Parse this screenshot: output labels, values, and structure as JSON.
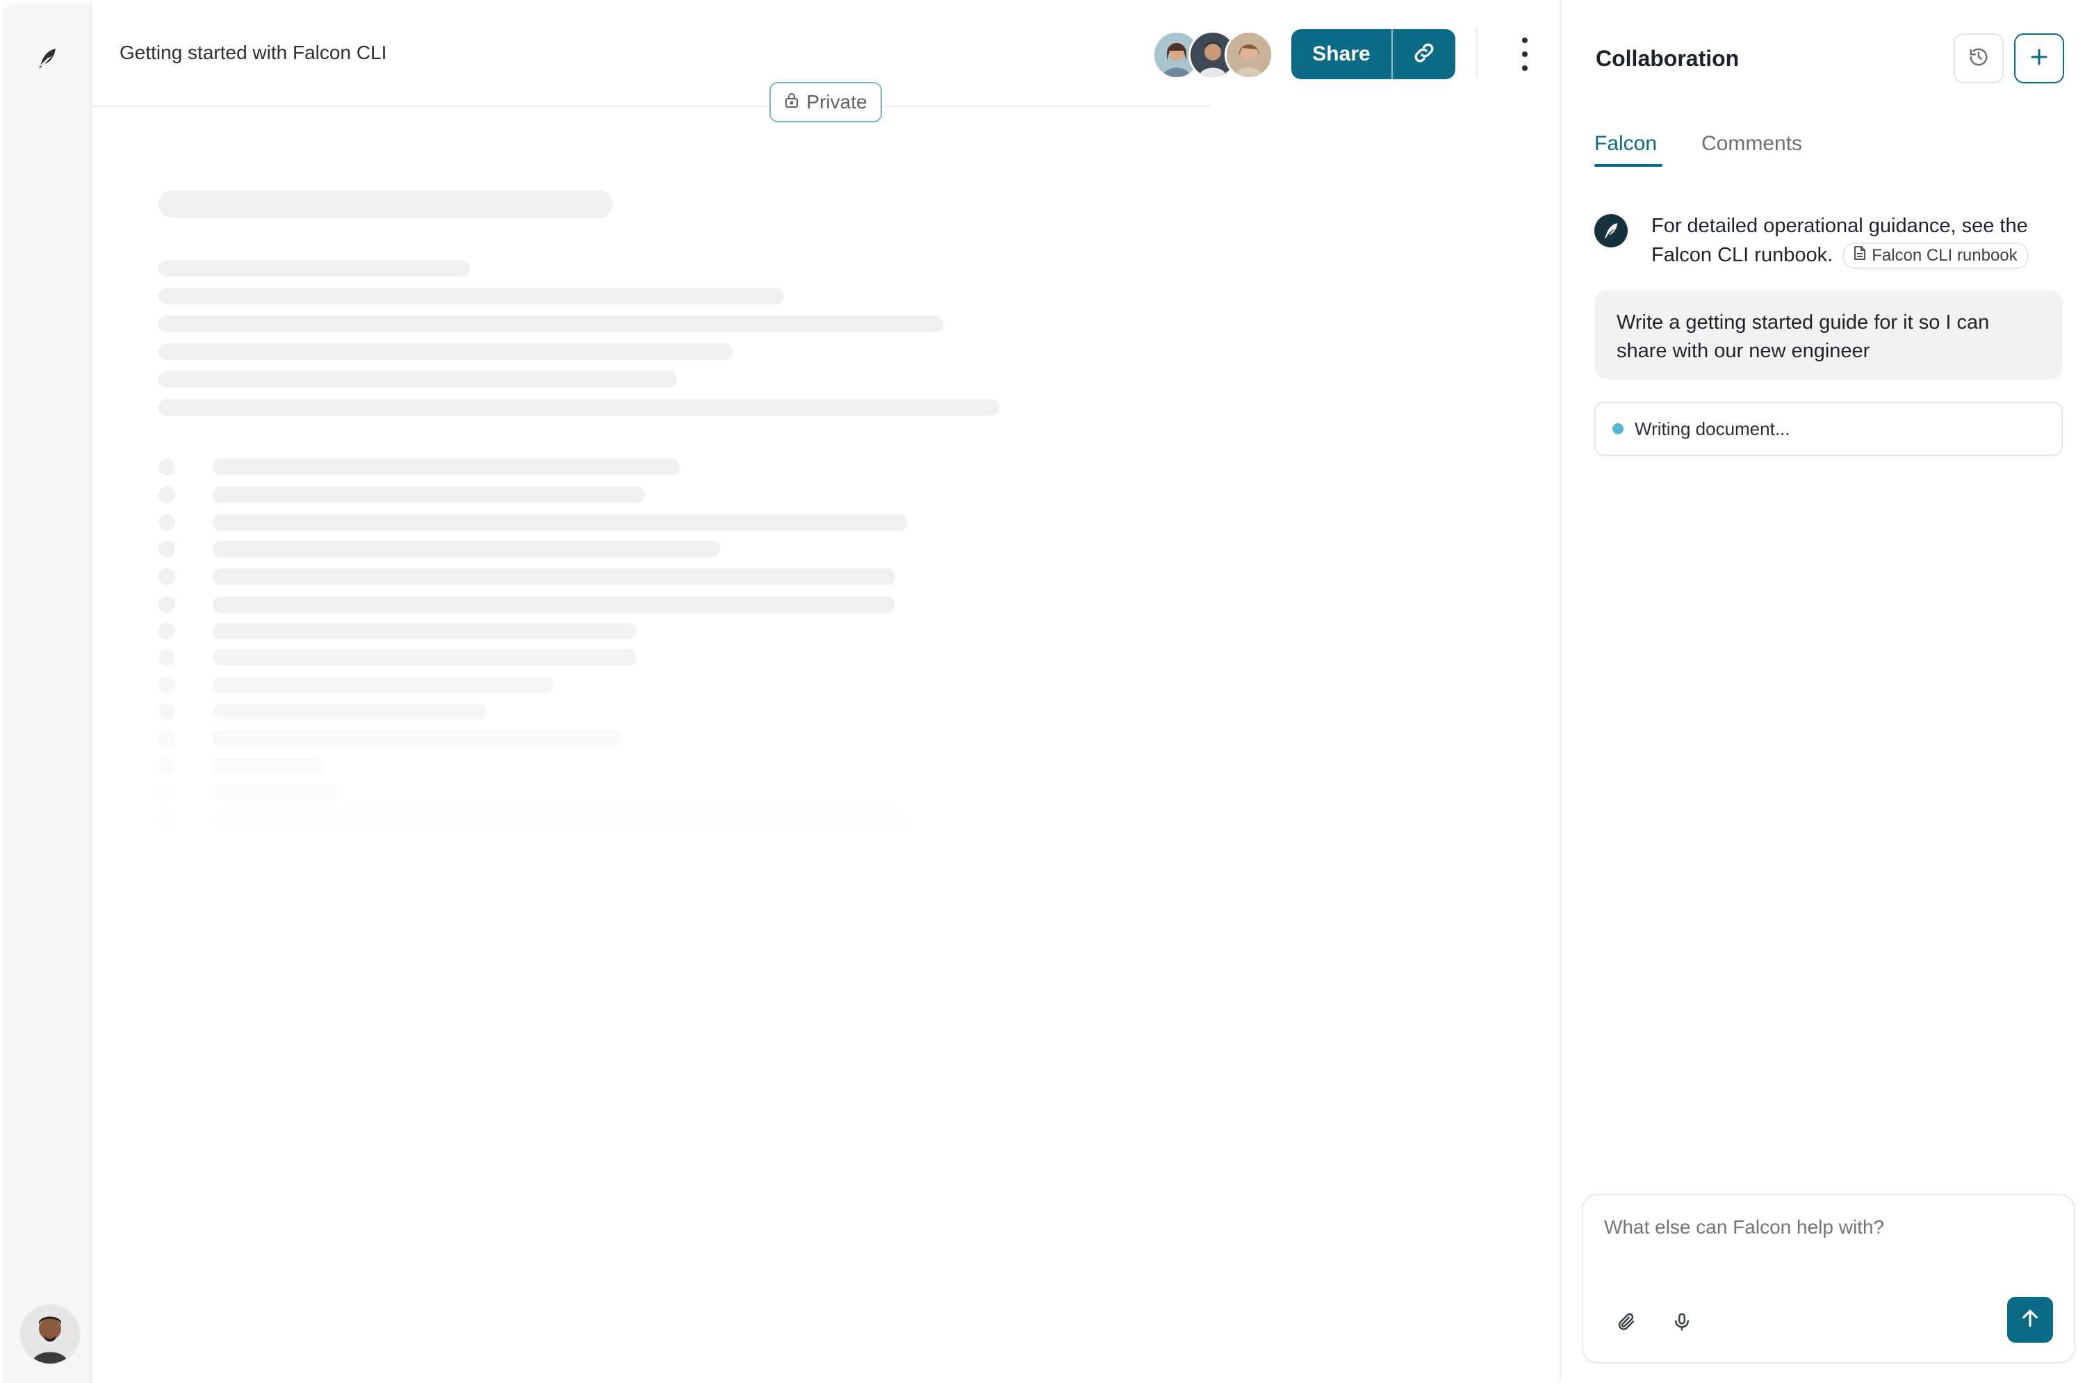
{
  "document": {
    "title": "Getting started with Falcon CLI",
    "visibility_label": "Private"
  },
  "toolbar": {
    "share_label": "Share",
    "collaborators": [
      "collaborator-1",
      "collaborator-2",
      "collaborator-3"
    ]
  },
  "panel": {
    "title": "Collaboration",
    "tabs": [
      {
        "label": "Falcon",
        "active": true
      },
      {
        "label": "Comments",
        "active": false
      }
    ],
    "messages": {
      "assistant_text": "For detailed operational guidance, see the Falcon CLI runbook.",
      "reference_chip": "Falcon CLI runbook",
      "user_text": "Write a getting started guide for it so I can share with our new engineer",
      "status_text": "Writing document..."
    },
    "composer": {
      "placeholder": "What else can Falcon help with?"
    }
  },
  "colors": {
    "accent": "#0b6a86",
    "status_dot": "#52b9d0",
    "skeleton": "#f0f0f0"
  },
  "icons": {
    "logo": "feather-icon",
    "link": "link-icon",
    "more": "vertical-dots-icon",
    "lock": "lock-icon",
    "history": "history-icon",
    "new": "plus-icon",
    "document": "document-icon",
    "attach": "paperclip-icon",
    "mic": "microphone-icon",
    "send": "arrow-up-icon"
  }
}
